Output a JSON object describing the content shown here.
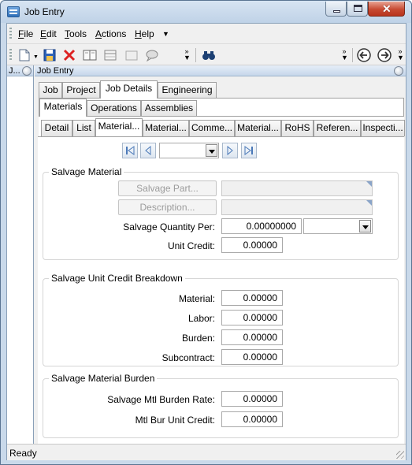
{
  "window": {
    "title": "Job Entry"
  },
  "menu": {
    "items": [
      {
        "prefix": "",
        "u": "F",
        "rest": "ile"
      },
      {
        "prefix": "",
        "u": "E",
        "rest": "dit"
      },
      {
        "prefix": "",
        "u": "T",
        "rest": "ools"
      },
      {
        "prefix": "",
        "u": "A",
        "rest": "ctions"
      },
      {
        "prefix": "",
        "u": "H",
        "rest": "elp"
      }
    ]
  },
  "toolbar": {
    "icons": [
      "new-document-icon",
      "save-icon",
      "delete-icon",
      "book-icon",
      "calendar-icon",
      "blank-icon",
      "speech-bubble-icon",
      "binoculars-icon",
      "back-arrow-icon",
      "forward-arrow-icon"
    ]
  },
  "left_panel": {
    "title": "J..."
  },
  "main_panel": {
    "title": "Job Entry"
  },
  "tabs_top": [
    "Job",
    "Project",
    "Job Details",
    "Engineering"
  ],
  "tabs_second": [
    "Materials",
    "Operations",
    "Assemblies"
  ],
  "tabs_third": [
    "Detail",
    "List",
    "Material...",
    "Material...",
    "Comme...",
    "Material...",
    "RoHS",
    "Referen...",
    "Inspecti..."
  ],
  "navigator": {
    "selected": ""
  },
  "salvage_material": {
    "title": "Salvage Material",
    "part_button": "Salvage Part...",
    "part_value": "",
    "desc_button": "Description...",
    "desc_value": "",
    "qty_label": "Salvage Quantity Per:",
    "qty_value": "0.00000000",
    "uom_value": "",
    "unit_credit_label": "Unit Credit:",
    "unit_credit_value": "0.00000"
  },
  "breakdown": {
    "title": "Salvage Unit Credit Breakdown",
    "rows": [
      {
        "label": "Material:",
        "value": "0.00000"
      },
      {
        "label": "Labor:",
        "value": "0.00000"
      },
      {
        "label": "Burden:",
        "value": "0.00000"
      },
      {
        "label": "Subcontract:",
        "value": "0.00000"
      }
    ]
  },
  "burden": {
    "title": "Salvage Material Burden",
    "rows": [
      {
        "label": "Salvage Mtl Burden Rate:",
        "value": "0.00000"
      },
      {
        "label": "Mtl Bur Unit Credit:",
        "value": "0.00000"
      }
    ]
  },
  "status": {
    "text": "Ready"
  },
  "colors": {
    "accent": "#c9d9ea",
    "close": "#c74a32"
  }
}
